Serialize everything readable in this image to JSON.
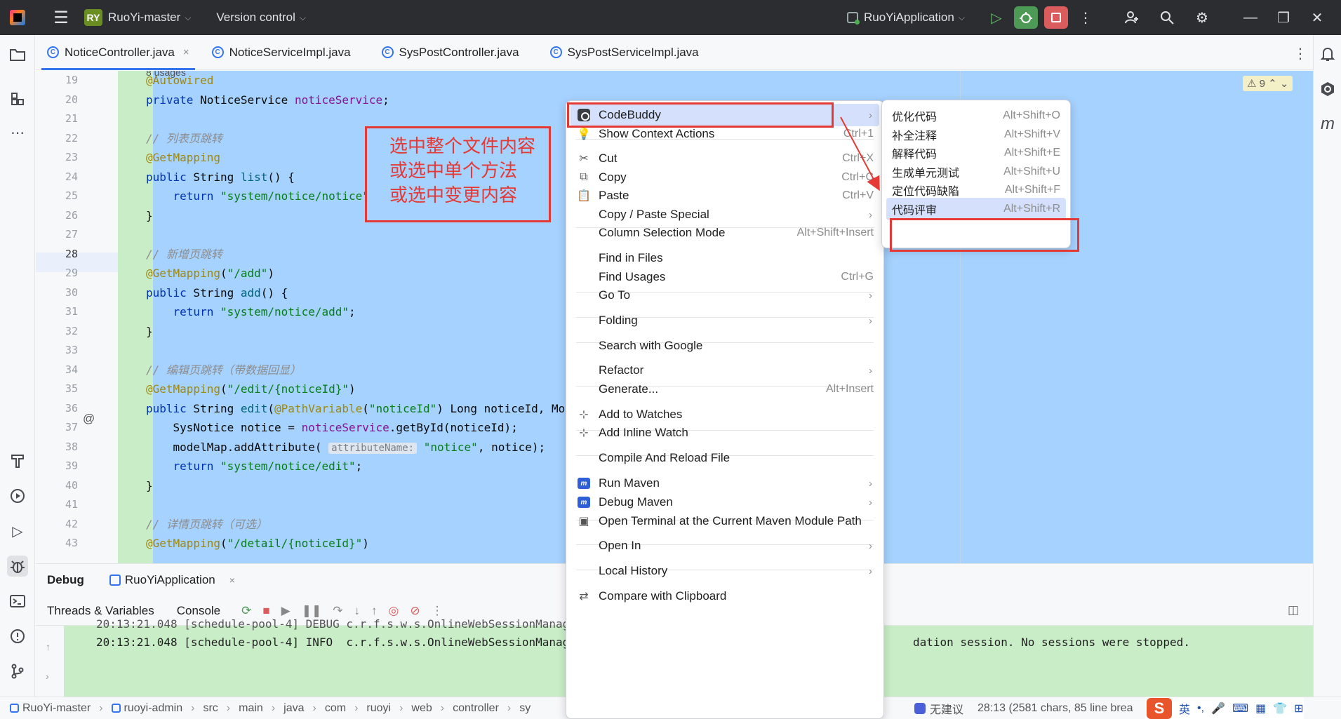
{
  "titlebar": {
    "project_badge": "RY",
    "project_name": "RuoYi-master",
    "vcs_label": "Version control",
    "run_config": "RuoYiApplication"
  },
  "tabs": [
    {
      "label": "NoticeController.java",
      "active": true
    },
    {
      "label": "NoticeServiceImpl.java",
      "active": false
    },
    {
      "label": "SysPostController.java",
      "active": false
    },
    {
      "label": "SysPostServiceImpl.java",
      "active": false
    }
  ],
  "editor": {
    "usages_hint": "8 usages",
    "warning_count": "9",
    "line_numbers": [
      "19",
      "20",
      "21",
      "22",
      "23",
      "24",
      "25",
      "26",
      "27",
      "28",
      "29",
      "30",
      "31",
      "32",
      "33",
      "34",
      "35",
      "36",
      "37",
      "38",
      "39",
      "40",
      "41",
      "42",
      "43"
    ],
    "current_line": "28",
    "inlay_hint": "attributeName:"
  },
  "annotation": {
    "line1": "选中整个文件内容",
    "line2": "或选中单个方法",
    "line3": "或选中变更内容"
  },
  "context_menu": {
    "items": [
      {
        "label": "CodeBuddy",
        "shortcut": "",
        "submenu": true,
        "icon": "codebuddy-icon"
      },
      {
        "label": "Show Context Actions",
        "shortcut": "Ctrl+1",
        "submenu": false,
        "icon": "bulb-icon"
      },
      {
        "label": "Cut",
        "shortcut": "Ctrl+X",
        "submenu": false,
        "icon": "scissors-icon"
      },
      {
        "label": "Copy",
        "shortcut": "Ctrl+C",
        "submenu": false,
        "icon": "copy-icon"
      },
      {
        "label": "Paste",
        "shortcut": "Ctrl+V",
        "submenu": false,
        "icon": "paste-icon"
      },
      {
        "label": "Copy / Paste Special",
        "shortcut": "",
        "submenu": true,
        "icon": ""
      },
      {
        "label": "Column Selection Mode",
        "shortcut": "Alt+Shift+Insert",
        "submenu": false,
        "icon": ""
      },
      {
        "label": "Find in Files",
        "shortcut": "",
        "submenu": false,
        "icon": ""
      },
      {
        "label": "Find Usages",
        "shortcut": "Ctrl+G",
        "submenu": false,
        "icon": ""
      },
      {
        "label": "Go To",
        "shortcut": "",
        "submenu": true,
        "icon": ""
      },
      {
        "label": "Folding",
        "shortcut": "",
        "submenu": true,
        "icon": ""
      },
      {
        "label": "Search with Google",
        "shortcut": "",
        "submenu": false,
        "icon": ""
      },
      {
        "label": "Refactor",
        "shortcut": "",
        "submenu": true,
        "icon": ""
      },
      {
        "label": "Generate...",
        "shortcut": "Alt+Insert",
        "submenu": false,
        "icon": ""
      },
      {
        "label": "Add to Watches",
        "shortcut": "",
        "submenu": false,
        "icon": "watch-icon"
      },
      {
        "label": "Add Inline Watch",
        "shortcut": "",
        "submenu": false,
        "icon": "watch-icon"
      },
      {
        "label": "Compile And Reload File",
        "shortcut": "",
        "submenu": false,
        "icon": ""
      },
      {
        "label": "Run Maven",
        "shortcut": "",
        "submenu": true,
        "icon": "maven-icon"
      },
      {
        "label": "Debug Maven",
        "shortcut": "",
        "submenu": true,
        "icon": "maven-icon"
      },
      {
        "label": "Open Terminal at the Current Maven Module Path",
        "shortcut": "",
        "submenu": false,
        "icon": "terminal-icon"
      },
      {
        "label": "Open In",
        "shortcut": "",
        "submenu": true,
        "icon": ""
      },
      {
        "label": "Local History",
        "shortcut": "",
        "submenu": true,
        "icon": ""
      },
      {
        "label": "Compare with Clipboard",
        "shortcut": "",
        "submenu": false,
        "icon": "compare-icon"
      }
    ]
  },
  "submenu": {
    "items": [
      {
        "label": "优化代码",
        "shortcut": "Alt+Shift+O"
      },
      {
        "label": "补全注释",
        "shortcut": "Alt+Shift+V"
      },
      {
        "label": "解释代码",
        "shortcut": "Alt+Shift+E"
      },
      {
        "label": "生成单元测试",
        "shortcut": "Alt+Shift+U"
      },
      {
        "label": "定位代码缺陷",
        "shortcut": "Alt+Shift+F"
      },
      {
        "label": "代码评审",
        "shortcut": "Alt+Shift+R"
      }
    ]
  },
  "debug": {
    "title": "Debug",
    "session_tab": "RuoYiApplication",
    "threads_tab": "Threads & Variables",
    "console_tab": "Console",
    "console_line_partial": "20:13:21.048 [schedule-pool-4] DEBUG c.r.f.s.w.s.OnlineWebSessionManager",
    "console_line": "20:13:21.048 [schedule-pool-4] INFO  c.r.f.s.w.s.OnlineWebSessionManag",
    "console_line_tail": "dation session. No sessions were stopped."
  },
  "statusbar": {
    "breadcrumbs": [
      "RuoYi-master",
      "ruoyi-admin",
      "src",
      "main",
      "java",
      "com",
      "ruoyi",
      "web",
      "controller",
      "sy"
    ],
    "codebuddy_status": "无建议",
    "position": "28:13 (2581 chars, 85 line brea",
    "ime_lang": "英"
  }
}
